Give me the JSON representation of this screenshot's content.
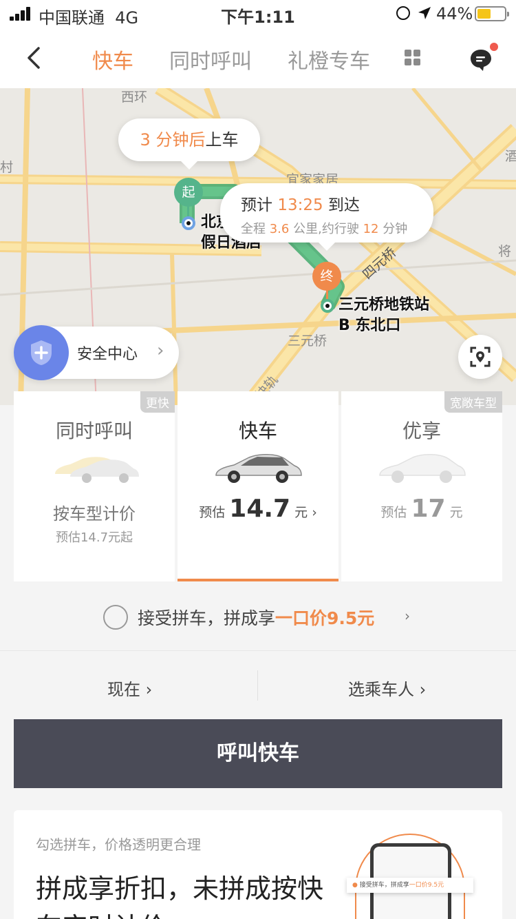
{
  "status_bar": {
    "carrier": "中国联通",
    "network": "4G",
    "time": "下午1:11",
    "battery": "44%"
  },
  "nav": {
    "tabs": [
      {
        "label": "快车",
        "active": true
      },
      {
        "label": "同时呼叫",
        "active": false
      },
      {
        "label": "礼橙专车",
        "active": false
      }
    ]
  },
  "map": {
    "pickup_eta": {
      "minutes": "3 分钟后",
      "suffix": "上车"
    },
    "route_eta": {
      "prefix": "预计",
      "arrival_time": "13:25",
      "arrive": "到达",
      "distance_prefix": "全程",
      "distance": "3.6",
      "distance_unit": "公里,约行驶",
      "duration": "12",
      "duration_unit": "分钟"
    },
    "start_pin": "起",
    "end_pin": "终",
    "start_place": {
      "line1": "北京",
      "line2": "假日酒店"
    },
    "end_place": {
      "line1": "三元桥地铁站",
      "line2": "B 东北口"
    },
    "labels": {
      "xihuan": "西环",
      "yijia": "宜家家居",
      "sanyuanqiao": "三元桥",
      "siyuan": "四元桥",
      "jiu": "酒",
      "jiang": "将",
      "kuaigui": "快轨",
      "cun": "村"
    },
    "safety_center": "安全中心"
  },
  "cars": [
    {
      "name": "同时呼叫",
      "tag": "更快",
      "subtitle": "按车型计价",
      "note": "预估14.7元起"
    },
    {
      "name": "快车",
      "price_prefix": "预估",
      "price": "14.7",
      "price_unit": "元",
      "selected": true
    },
    {
      "name": "优享",
      "tag": "宽敞车型",
      "price_prefix": "预估",
      "price": "17",
      "price_unit": "元"
    }
  ],
  "carpool": {
    "text": "接受拼车，拼成享",
    "highlight": "一口价9.5元"
  },
  "options": {
    "time": "现在",
    "passenger": "选乘车人"
  },
  "call_button": "呼叫快车",
  "promo": {
    "subtitle": "勾选拼车，价格透明更合理",
    "title": "拼成享折扣，未拼成按快车实时计价"
  },
  "colors": {
    "accent": "#f08a4b",
    "route": "#4cae73",
    "button": "#4a4b57"
  }
}
